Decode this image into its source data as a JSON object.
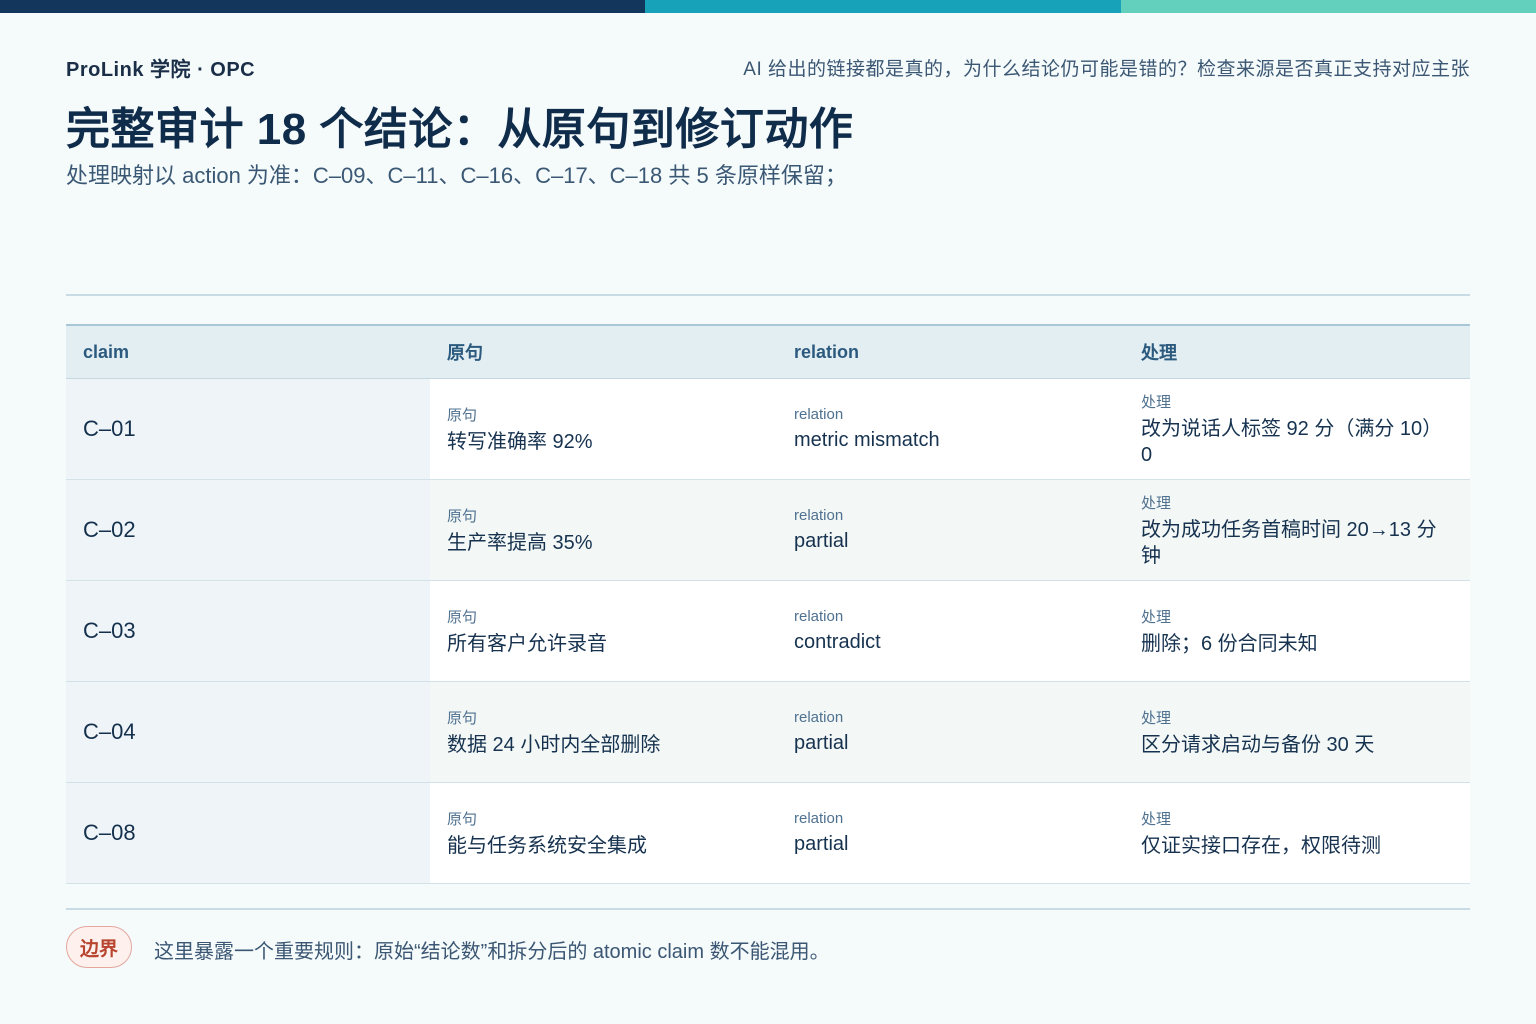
{
  "brand": "ProLink 学院 · OPC",
  "question": "AI 给出的链接都是真的，为什么结论仍可能是错的？检查来源是否真正支持对应主张",
  "title": "完整审计 18 个结论：从原句到修订动作",
  "subtitle": "处理映射以 action 为准：C–09、C–11、C–16、C–17、C–18 共 5 条原样保留；",
  "table": {
    "headers": [
      "claim",
      "原句",
      "relation",
      "处理"
    ],
    "cell_labels": {
      "sentence": "原句",
      "relation": "relation",
      "action": "处理"
    },
    "rows": [
      {
        "claim": "C–01",
        "sentence": "转写准确率 92%",
        "relation": "metric mismatch",
        "action": "改为说话人标签 92 分（满分 10）0"
      },
      {
        "claim": "C–02",
        "sentence": "生产率提高 35%",
        "relation": "partial",
        "action": "改为成功任务首稿时间 20→13 分钟"
      },
      {
        "claim": "C–03",
        "sentence": "所有客户允许录音",
        "relation": "contradict",
        "action": "删除；6 份合同未知"
      },
      {
        "claim": "C–04",
        "sentence": "数据 24 小时内全部删除",
        "relation": "partial",
        "action": "区分请求启动与备份 30 天"
      },
      {
        "claim": "C–08",
        "sentence": "能与任务系统安全集成",
        "relation": "partial",
        "action": "仅证实接口存在，权限待测"
      }
    ]
  },
  "footer": {
    "tag": "边界",
    "note": "这里暴露一个重要规则：原始“结论数”和拆分后的 atomic claim 数不能混用。"
  }
}
